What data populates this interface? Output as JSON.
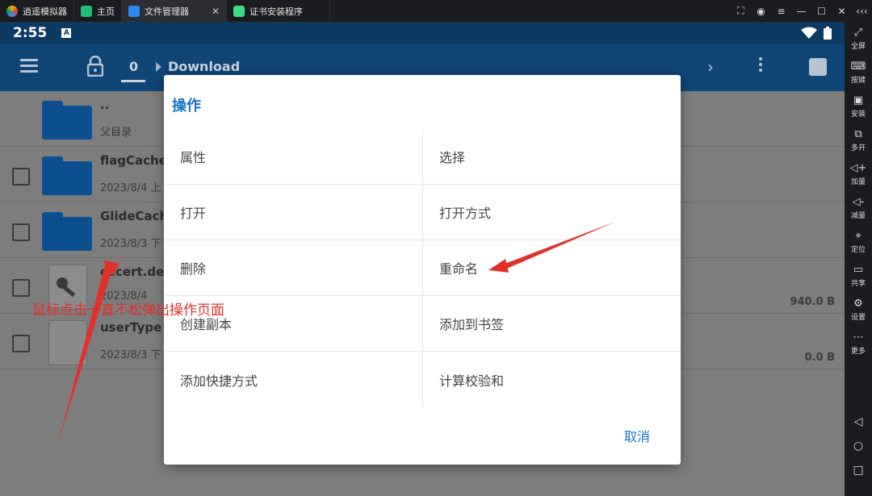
{
  "titlebar": {
    "tabs": [
      {
        "label": "逍遥模拟器",
        "icon": "emulator-logo-icon",
        "active": false
      },
      {
        "label": "主页",
        "icon": "home-app-icon",
        "active": false
      },
      {
        "label": "文件管理器",
        "icon": "file-manager-app-icon",
        "active": true
      },
      {
        "label": "证书安装程序",
        "icon": "android-app-icon",
        "active": false
      }
    ]
  },
  "statusbar": {
    "time": "2:55",
    "notification": "A"
  },
  "appbar": {
    "crumb_root": "0",
    "crumb_folder": "Download"
  },
  "files": [
    {
      "name": "..",
      "meta": "父目录",
      "size": "",
      "type": "folder",
      "checkbox": false
    },
    {
      "name": "flagCache",
      "meta": "2023/8/4 上",
      "size": "",
      "type": "folder",
      "checkbox": true
    },
    {
      "name": "GlideCach",
      "meta": "2023/8/3 下",
      "size": "",
      "type": "folder",
      "checkbox": true
    },
    {
      "name": "cacert.der",
      "meta": "2023/8/4",
      "size": "940.0 B",
      "type": "cert",
      "checkbox": true
    },
    {
      "name": "userType",
      "meta": "2023/8/3 下",
      "size": "0.0 B",
      "type": "file",
      "checkbox": true
    }
  ],
  "dialog": {
    "title": "操作",
    "actions": [
      [
        "属性",
        "选择"
      ],
      [
        "打开",
        "打开方式"
      ],
      [
        "删除",
        "重命名"
      ],
      [
        "创建副本",
        "添加到书签"
      ],
      [
        "添加快捷方式",
        "计算校验和"
      ]
    ],
    "cancel": "取消"
  },
  "annotation": "鼠标点击一直不松弹出操作页面",
  "colors": {
    "accent": "#1a73c7",
    "annotation": "#e2302b",
    "appbar": "#0f4577"
  },
  "sidebar": [
    {
      "label": "全屏",
      "icon": "fullscreen-icon"
    },
    {
      "label": "按键",
      "icon": "keyboard-icon"
    },
    {
      "label": "安装",
      "icon": "apk-install-icon"
    },
    {
      "label": "多开",
      "icon": "multi-instance-icon"
    },
    {
      "label": "加量",
      "icon": "volume-up-icon"
    },
    {
      "label": "减量",
      "icon": "volume-down-icon"
    },
    {
      "label": "定位",
      "icon": "location-icon"
    },
    {
      "label": "共享",
      "icon": "shared-folder-icon"
    },
    {
      "label": "设置",
      "icon": "gear-icon"
    },
    {
      "label": "更多",
      "icon": "more-icon"
    }
  ]
}
